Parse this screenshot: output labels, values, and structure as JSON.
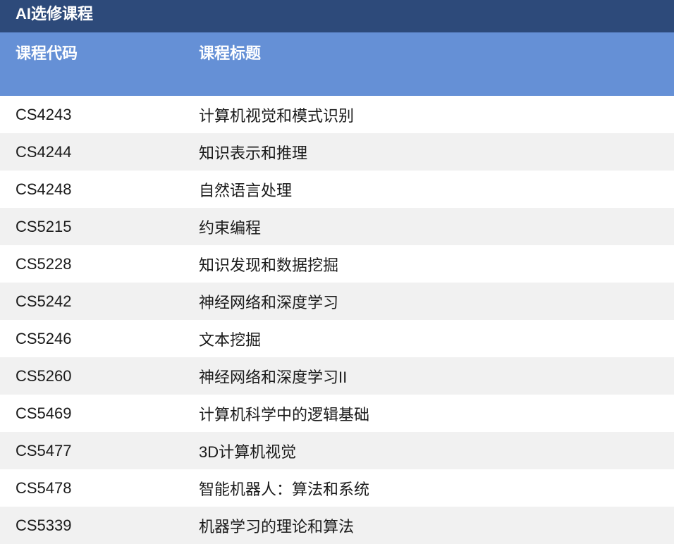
{
  "table": {
    "title": "AI选修课程",
    "headers": {
      "code": "课程代码",
      "title": "课程标题"
    },
    "rows": [
      {
        "code": "CS4243",
        "title": "计算机视觉和模式识别"
      },
      {
        "code": "CS4244",
        "title": "知识表示和推理"
      },
      {
        "code": "CS4248",
        "title": "自然语言处理"
      },
      {
        "code": "CS5215",
        "title": "约束编程"
      },
      {
        "code": "CS5228",
        "title": "知识发现和数据挖掘"
      },
      {
        "code": "CS5242",
        "title": "神经网络和深度学习"
      },
      {
        "code": "CS5246",
        "title": "文本挖掘"
      },
      {
        "code": "CS5260",
        "title": "神经网络和深度学习II"
      },
      {
        "code": "CS5469",
        "title": "计算机科学中的逻辑基础"
      },
      {
        "code": "CS5477",
        "title": "3D计算机视觉"
      },
      {
        "code": "CS5478",
        "title": "智能机器人：算法和系统"
      },
      {
        "code": "CS5339",
        "title": "机器学习的理论和算法"
      }
    ]
  },
  "colors": {
    "title_bar": "#2d4a7a",
    "header_row": "#6590d6",
    "stripe": "#f1f1f1"
  }
}
